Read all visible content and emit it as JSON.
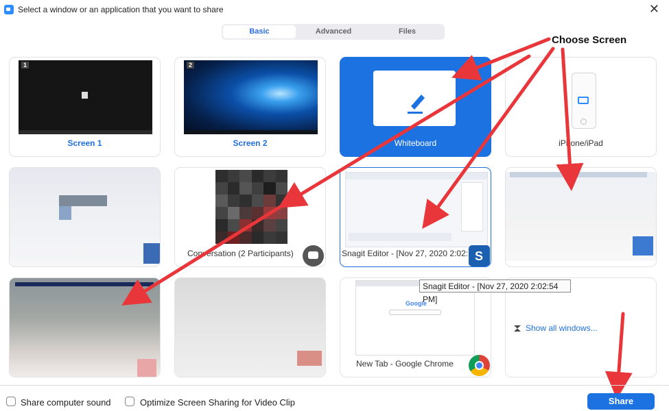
{
  "window": {
    "title": "Select a window or an application that you want to share",
    "close_label": "✕"
  },
  "tabs": [
    {
      "label": "Basic",
      "active": true
    },
    {
      "label": "Advanced",
      "active": false
    },
    {
      "label": "Files",
      "active": false
    }
  ],
  "tiles": {
    "screen1": {
      "label": "Screen 1",
      "number": "1"
    },
    "screen2": {
      "label": "Screen 2",
      "number": "2"
    },
    "whiteboard": {
      "label": "Whiteboard"
    },
    "iphone": {
      "label": "iPhone/iPad"
    },
    "conversation": {
      "label": "Conversation (2 Participants)"
    },
    "snagit": {
      "label": "Snagit Editor - [Nov 27, 2020 2:02:..."
    },
    "chrome": {
      "label": "New Tab - Google Chrome"
    },
    "show_all": {
      "label": "Show all windows..."
    }
  },
  "tooltip": "Snagit Editor - [Nov 27, 2020 2:02:54 PM]",
  "annotation": "Choose Screen",
  "bottom": {
    "sound_label": "Share computer sound",
    "optimize_label": "Optimize Screen Sharing for Video Clip",
    "share_label": "Share"
  },
  "colors": {
    "accent": "#1c72e0",
    "arrow": "#e8363a"
  }
}
